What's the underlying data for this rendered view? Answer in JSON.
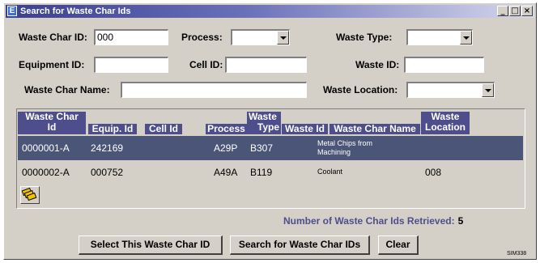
{
  "window": {
    "title": "Search for Waste Char Ids",
    "app_icon_glyph": "E",
    "controls": {
      "minimize": "_",
      "maximize": "□",
      "close": "×"
    }
  },
  "form": {
    "waste_char_id": {
      "label": "Waste Char ID:",
      "value": "000"
    },
    "process": {
      "label": "Process:",
      "value": ""
    },
    "waste_type": {
      "label": "Waste Type:",
      "value": ""
    },
    "equipment_id": {
      "label": "Equipment ID:",
      "value": ""
    },
    "cell_id": {
      "label": "Cell ID:",
      "value": ""
    },
    "waste_id": {
      "label": "Waste ID:",
      "value": ""
    },
    "waste_char_name": {
      "label": "Waste Char Name:",
      "value": ""
    },
    "waste_location": {
      "label": "Waste Location:",
      "value": ""
    }
  },
  "grid": {
    "columns": [
      "Waste Char Id",
      "Equip. Id",
      "Cell Id",
      "Process",
      "Waste Type",
      "Waste Id",
      "Waste Char Name",
      "Waste Location"
    ],
    "column_header_lines": {
      "waste_char_id": [
        "Waste Char",
        "Id"
      ],
      "equip_id": [
        "Equip. Id"
      ],
      "cell_id": [
        "Cell Id"
      ],
      "process": [
        "Process"
      ],
      "waste_type": [
        "Waste",
        "Type"
      ],
      "waste_id": [
        "Waste Id"
      ],
      "waste_char_name": [
        "Waste Char Name"
      ],
      "waste_location": [
        "Waste",
        "Location"
      ]
    },
    "rows": [
      {
        "waste_char_id": "0000001-A",
        "equip_id": "242169",
        "cell_id": "",
        "process": "A29P",
        "waste_type": "B307",
        "waste_id": "",
        "waste_char_name": "Metal Chips from Machining",
        "waste_location": "",
        "selected": true
      },
      {
        "waste_char_id": "0000002-A",
        "equip_id": "000752",
        "cell_id": "",
        "process": "A49A",
        "waste_type": "B119",
        "waste_id": "",
        "waste_char_name": "Coolant",
        "waste_location": "008",
        "selected": false
      }
    ],
    "icon_button": "stacked-records-icon"
  },
  "status": {
    "count_label": "Number of Waste Char Ids Retrieved:",
    "count_value": "5"
  },
  "buttons": {
    "select": "Select This Waste Char ID",
    "search": "Search for Waste Char IDs",
    "clear": "Clear"
  },
  "footer": {
    "sim_code": "SIM338"
  },
  "colors": {
    "header_bg": "#4f4e8c",
    "selected_row_bg": "#4a5577",
    "window_bg": "#d4d0c8",
    "count_label_color": "#4f4e8c"
  }
}
